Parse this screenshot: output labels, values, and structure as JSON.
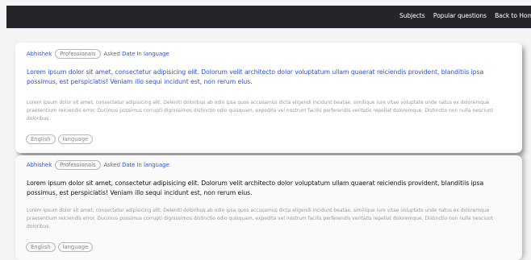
{
  "nav": {
    "links": [
      "Subjects",
      "Popular questions",
      "Back to Hom"
    ]
  },
  "questions": [
    {
      "author": "Abhishek",
      "role": "Professionals",
      "asked_prefix": "Asked",
      "date_label": "Date",
      "in_label": "In",
      "subject": "language",
      "title": "Lorem ipsum dolor sit amet, consectetur adipisicing elit. Dolorum velit architecto dolor voluptatum ullam quaerat reiciendis provident, blanditiis ipsa possimus, est perspiciatis! Veniam illo sequi incidunt est, non rerum eius.",
      "body": "Lorem ipsum dolor sit amet, consectetur adipisicing elit. Deleniti doloribus ab odio ipsa quos accusamus dicta eligendi incidunt beatae, similique iure vitae voluptate unde natus ex doloremque praesentium reiciendis error. Ducimus possimus corrupti dignissimos distinctio odio quisquam, expedita vel nostrum facilis perferendis veritatis repellat doloremque. Distinctio non nulla nesciunt doloribus.",
      "tags": [
        "English",
        "language"
      ]
    },
    {
      "author": "Abhishek",
      "role": "Professionals",
      "asked_prefix": "Asked",
      "date_label": "Date",
      "in_label": "In",
      "subject": "language",
      "title": "Lorem ipsum dolor sit amet, consectetur adipisicing elit. Dolorum velit architecto dolor voluptatum ullam quaerat reiciendis provident, blanditiis ipsa possimus, est perspiciatis! Veniam illo sequi incidunt est, non rerum eius.",
      "body": "Lorem ipsum dolor sit amet, consectetur adipisicing elit. Deleniti doloribus ab odio ipsa quos accusamus dicta eligendi incidunt beatae, similique iure vitae voluptate unde natus ex doloremque praesentium reiciendis error. Ducimus possimus corrupti dignissimos distinctio odio quisquam, expedita vel nostrum facilis perferendis veritatis repellat doloremque. Distinctio non nulla nesciunt doloribus.",
      "tags": [
        "English",
        "language"
      ]
    }
  ]
}
